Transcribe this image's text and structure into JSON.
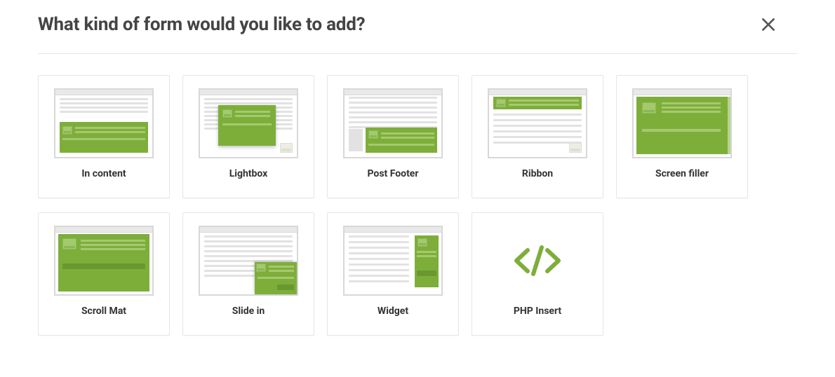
{
  "title": "What kind of form would you like to add?",
  "options": [
    {
      "id": "in-content",
      "label": "In content"
    },
    {
      "id": "lightbox",
      "label": "Lightbox"
    },
    {
      "id": "post-footer",
      "label": "Post Footer"
    },
    {
      "id": "ribbon",
      "label": "Ribbon"
    },
    {
      "id": "screen-filler",
      "label": "Screen filler"
    },
    {
      "id": "scroll-mat",
      "label": "Scroll Mat"
    },
    {
      "id": "slide-in",
      "label": "Slide in"
    },
    {
      "id": "widget",
      "label": "Widget"
    },
    {
      "id": "php-insert",
      "label": "PHP Insert"
    }
  ],
  "icons": {
    "close": "close-icon"
  },
  "colors": {
    "accent": "#7eae3a"
  }
}
